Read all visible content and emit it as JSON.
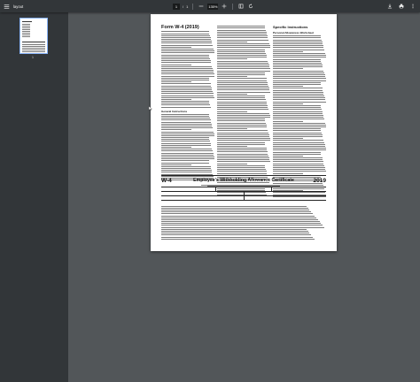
{
  "toolbar": {
    "title": "layout",
    "page_current": "1",
    "page_sep": "/",
    "page_total": "1",
    "zoom": "135%",
    "menu_icon": "menu-icon",
    "zoom_out_icon": "minus-icon",
    "zoom_in_icon": "plus-icon",
    "fit_icon": "fit-page-icon",
    "rotate_icon": "rotate-icon",
    "download_icon": "download-icon",
    "print_icon": "print-icon",
    "more_icon": "more-vert-icon"
  },
  "sidebar": {
    "thumb_number": "1"
  },
  "page": {
    "form_title": "Form W-4 (2019)",
    "general_heading": "General Instructions",
    "specific_heading": "Specific Instructions",
    "personal_worksheet": "Personal Allowances Worksheet",
    "w4": {
      "form": "W-4",
      "title": "Employee's Withholding Allowance Certificate",
      "year": "2019"
    }
  },
  "colors": {
    "toolbar_bg": "#323639",
    "viewer_bg": "#525659",
    "thumb_border": "#8ab4f8"
  }
}
